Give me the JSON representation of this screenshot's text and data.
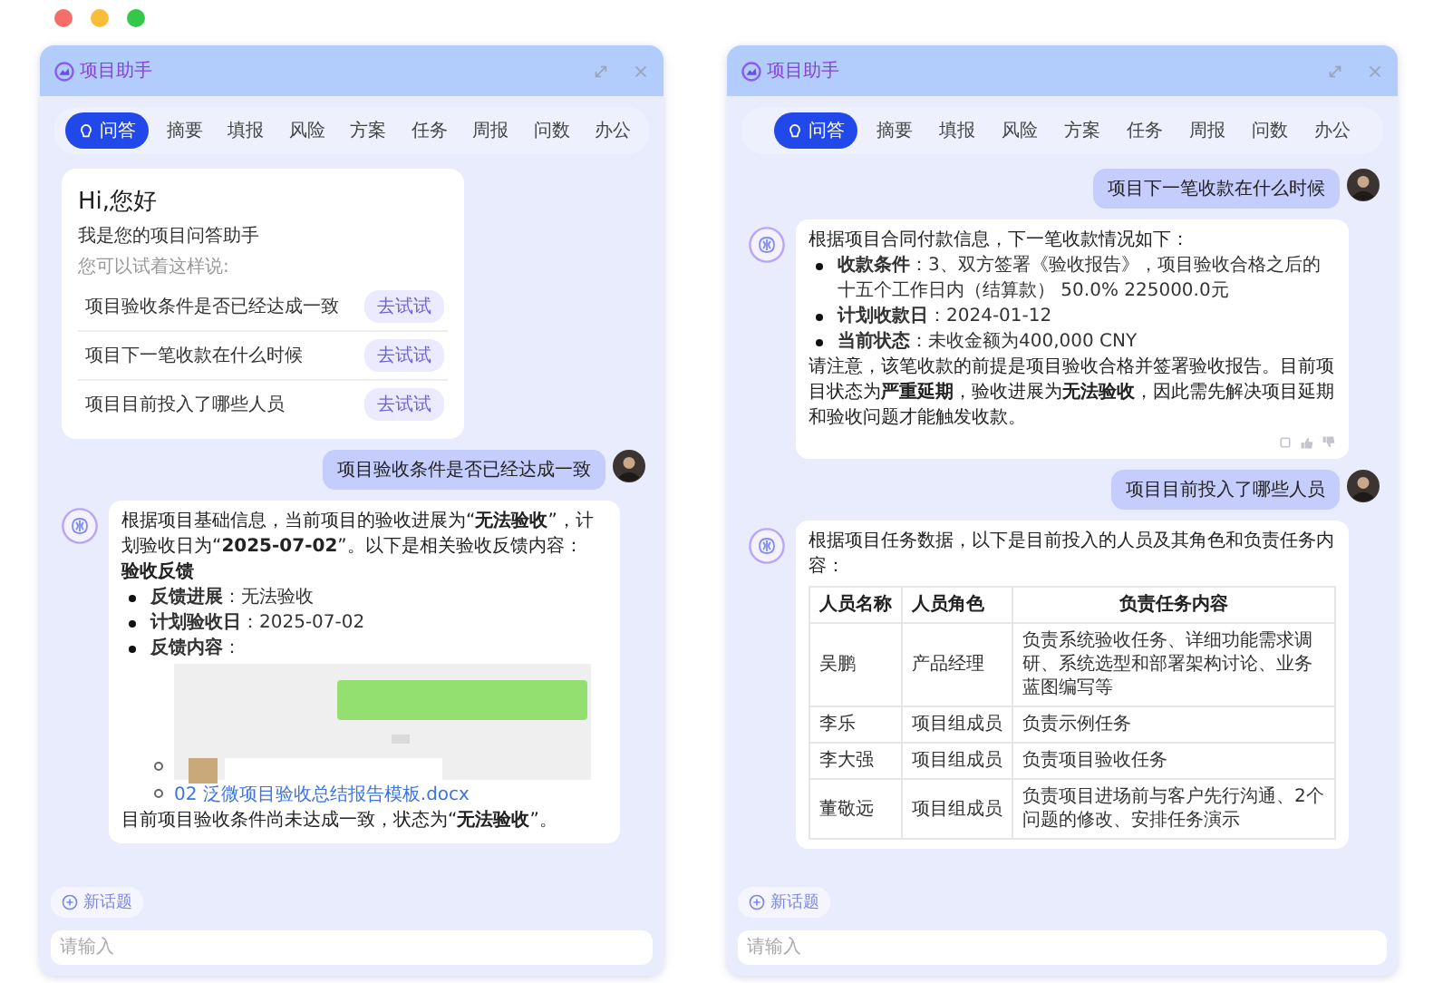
{
  "windows": [
    {
      "title": "项目助手",
      "tabs": [
        {
          "label": "问答",
          "selected": true
        },
        {
          "label": "摘要",
          "selected": false
        },
        {
          "label": "填报",
          "selected": false
        },
        {
          "label": "风险",
          "selected": false
        },
        {
          "label": "方案",
          "selected": false
        },
        {
          "label": "任务",
          "selected": false
        },
        {
          "label": "周报",
          "selected": false
        },
        {
          "label": "问数",
          "selected": false
        },
        {
          "label": "办公",
          "selected": false
        }
      ],
      "messages": [
        {
          "kind": "welcome",
          "greeting": "Hi,您好",
          "intro": "我是您的项目问答助手",
          "hint": "您可以试着这样说:",
          "suggestions": [
            {
              "text": "项目验收条件是否已经达成一致",
              "action": "去试试"
            },
            {
              "text": "项目下一笔收款在什么时候",
              "action": "去试试"
            },
            {
              "text": "项目目前投入了哪些人员",
              "action": "去试试"
            }
          ]
        },
        {
          "kind": "user",
          "text": "项目验收条件是否已经达成一致"
        },
        {
          "kind": "bot",
          "feedback": false,
          "blocks": [
            {
              "kind": "paragraph",
              "text": "根据项目基础信息，当前项目的验收进展为“**无法验收**”，计划验收日为“**2025-07-02**”。以下是相关验收反馈内容："
            },
            {
              "kind": "heading",
              "text": "验收反馈"
            },
            {
              "kind": "bullets",
              "items": [
                {
                  "text": "**反馈进展**：无法验收"
                },
                {
                  "text": "**计划验收日**：2025-07-02"
                },
                {
                  "text": "**反馈内容**：",
                  "children": [
                    {
                      "kind": "image"
                    },
                    {
                      "kind": "link",
                      "text": "02 泛微项目验收总结报告模板.docx"
                    }
                  ]
                }
              ]
            },
            {
              "kind": "paragraph",
              "text": "目前项目验收条件尚未达成一致，状态为“**无法验收**”。"
            }
          ]
        }
      ],
      "new_topic": "新话题",
      "input_placeholder": "请输入"
    },
    {
      "title": "项目助手",
      "tabs": [
        {
          "label": "问答",
          "selected": true
        },
        {
          "label": "摘要",
          "selected": false
        },
        {
          "label": "填报",
          "selected": false
        },
        {
          "label": "风险",
          "selected": false
        },
        {
          "label": "方案",
          "selected": false
        },
        {
          "label": "任务",
          "selected": false
        },
        {
          "label": "周报",
          "selected": false
        },
        {
          "label": "问数",
          "selected": false
        },
        {
          "label": "办公",
          "selected": false
        }
      ],
      "messages": [
        {
          "kind": "user",
          "text": "项目下一笔收款在什么时候"
        },
        {
          "kind": "bot",
          "feedback": true,
          "blocks": [
            {
              "kind": "paragraph",
              "text": "根据项目合同付款信息，下一笔收款情况如下："
            },
            {
              "kind": "bullets",
              "items": [
                {
                  "text": "**收款条件**：3、双方签署《验收报告》，项目验收合格之后的十五个工作日内（结算款） 50.0% 225000.0元"
                },
                {
                  "text": "**计划收款日**：2024-01-12"
                },
                {
                  "text": "**当前状态**：未收金额为400,000 CNY"
                }
              ]
            },
            {
              "kind": "paragraph",
              "text": "请注意，该笔收款的前提是项目验收合格并签署验收报告。目前项目状态为**严重延期**，验收进展为**无法验收**，因此需先解决项目延期和验收问题才能触发收款。"
            }
          ]
        },
        {
          "kind": "user",
          "text": "项目目前投入了哪些人员"
        },
        {
          "kind": "bot",
          "feedback": false,
          "blocks": [
            {
              "kind": "paragraph",
              "text": "根据项目任务数据，以下是目前投入的人员及其角色和负责任务内容："
            },
            {
              "kind": "table",
              "columns": [
                "人员名称",
                "人员角色",
                "负责任务内容"
              ],
              "rows": [
                [
                  "吴鹏",
                  "产品经理",
                  "负责系统验收任务、详细功能需求调研、系统选型和部署架构讨论、业务蓝图编写等"
                ],
                [
                  "李乐",
                  "项目组成员",
                  "负责示例任务"
                ],
                [
                  "李大强",
                  "项目组成员",
                  "负责项目验收任务"
                ],
                [
                  "董敬远",
                  "项目组成员",
                  "负责项目进场前与客户先行沟通、2个问题的修改、安排任务演示"
                ]
              ]
            }
          ]
        }
      ],
      "new_topic": "新话题",
      "input_placeholder": "请输入"
    }
  ]
}
